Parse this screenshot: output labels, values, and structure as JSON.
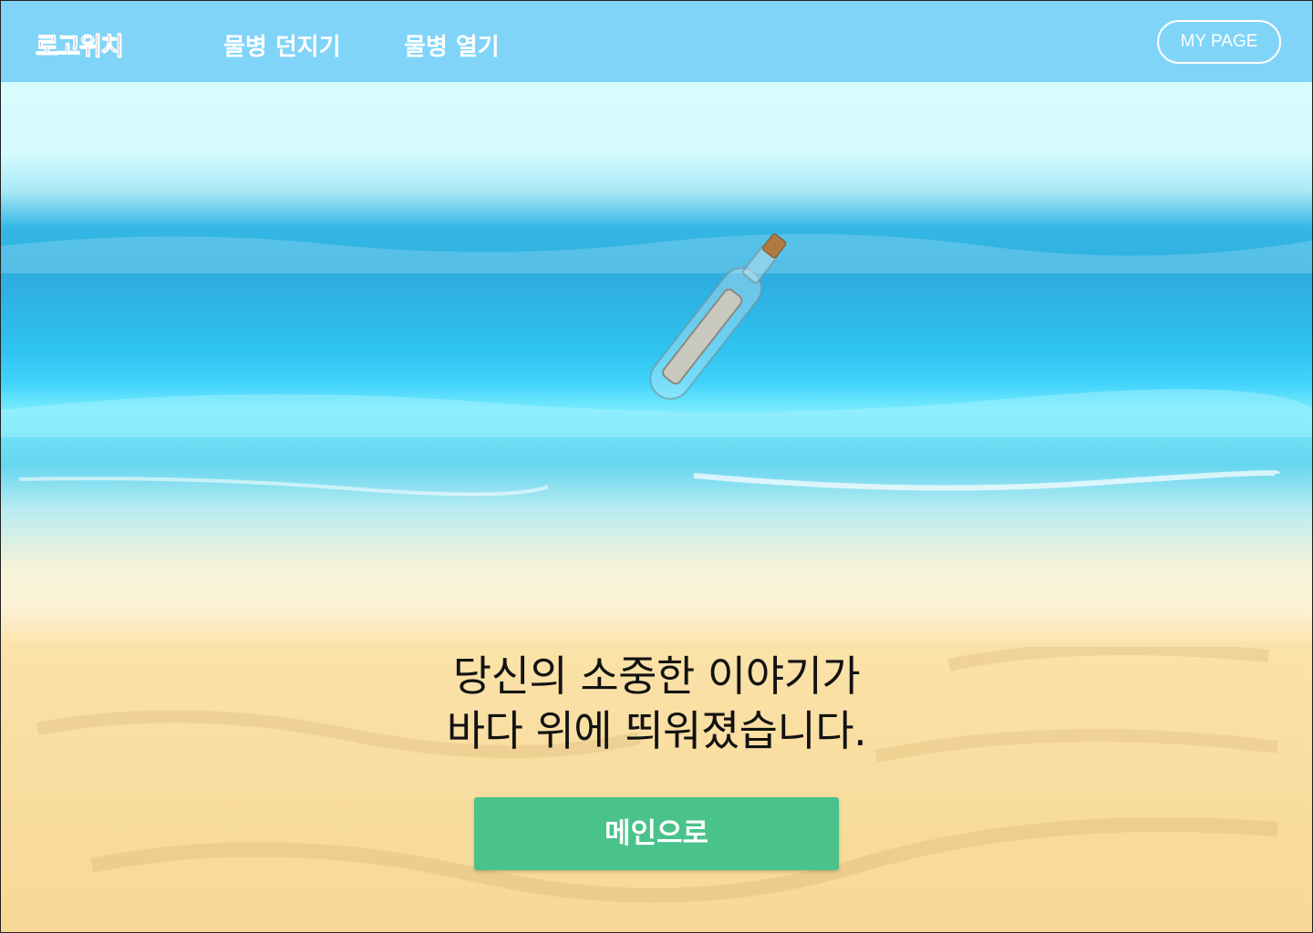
{
  "header": {
    "logo": "로고위치",
    "nav": [
      {
        "label": "물병 던지기"
      },
      {
        "label": "물병 열기"
      }
    ],
    "mypage_label": "MY PAGE"
  },
  "main": {
    "message_line1": "당신의 소중한 이야기가",
    "message_line2": "바다 위에 띄워졌습니다.",
    "button_label": "메인으로"
  },
  "colors": {
    "header_bg": "#80d4f8",
    "button_bg": "#49c389",
    "sea": "#2ec2ef",
    "sand": "#f9dda0"
  },
  "icons": {
    "bottle": "message-in-bottle-illustration"
  }
}
